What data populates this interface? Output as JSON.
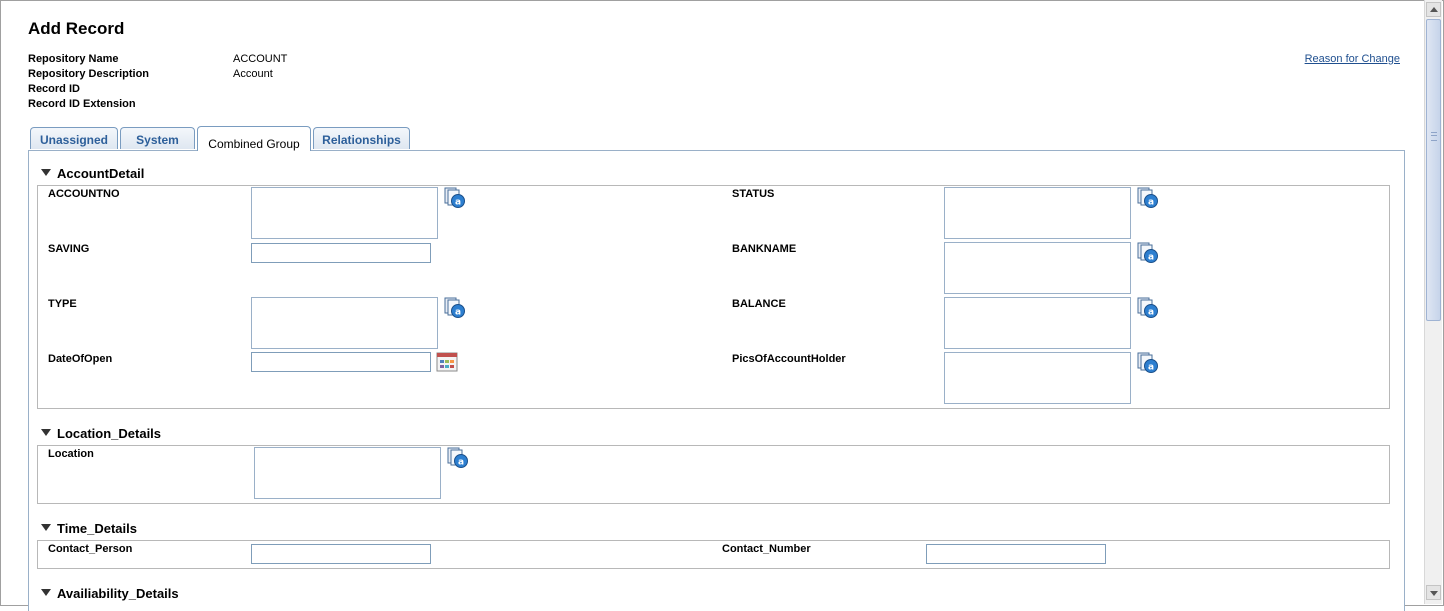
{
  "page": {
    "title": "Add Record",
    "reason_link": "Reason for Change"
  },
  "meta": [
    {
      "label": "Repository Name",
      "value": "ACCOUNT"
    },
    {
      "label": "Repository Description",
      "value": "Account"
    },
    {
      "label": "Record ID",
      "value": ""
    },
    {
      "label": "Record ID Extension",
      "value": ""
    }
  ],
  "tabs": [
    {
      "label": "Unassigned",
      "active": false
    },
    {
      "label": "System",
      "active": false
    },
    {
      "label": "Combined Group",
      "active": true
    },
    {
      "label": "Relationships",
      "active": false
    }
  ],
  "sections": {
    "account_detail": {
      "title": "AccountDetail",
      "fields": {
        "accountno": "ACCOUNTNO",
        "status": "STATUS",
        "saving": "SAVING",
        "bankname": "BANKNAME",
        "type": "TYPE",
        "balance": "BALANCE",
        "dateofopen": "DateOfOpen",
        "pics": "PicsOfAccountHolder"
      }
    },
    "location_details": {
      "title": "Location_Details",
      "fields": {
        "location": "Location"
      }
    },
    "time_details": {
      "title": "Time_Details",
      "fields": {
        "contact_person": "Contact_Person",
        "contact_number": "Contact_Number"
      }
    },
    "availability_details": {
      "title": "Availiability_Details"
    }
  },
  "icons": {
    "rich_text": "rich-text-editor-icon",
    "calendar": "calendar-icon"
  }
}
